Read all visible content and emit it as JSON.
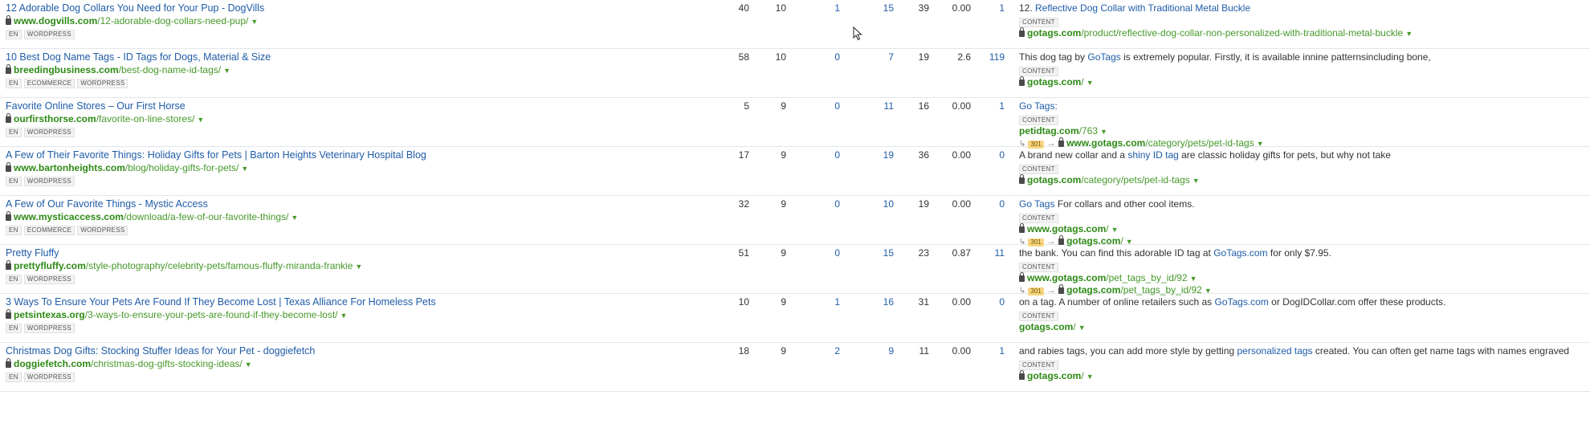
{
  "rows": [
    {
      "title": "12 Adorable Dog Collars You Need for Your Pup - DogVills",
      "domain": "www.dogvills.com",
      "path": "/12-adorable-dog-collars-need-pup/",
      "tags": [
        "EN",
        "WORDPRESS"
      ],
      "nums": [
        "40",
        "10",
        "1",
        "15",
        "39",
        "0.00",
        "1"
      ],
      "anchor_pre": "12. ",
      "anchor_link": "Reflective Dog Collar with Traditional Metal Buckle",
      "anchor_post": "",
      "content_label": "CONTENT",
      "target_domain": "gotags.com",
      "target_path": "/product/reflective-dog-collar-non-personalized-with-traditional-metal-buckle",
      "target_secure": true
    },
    {
      "title": "10 Best Dog Name Tags - ID Tags for Dogs, Material & Size",
      "domain": "breedingbusiness.com",
      "path": "/best-dog-name-id-tags/",
      "tags": [
        "EN",
        "ECOMMERCE",
        "WORDPRESS"
      ],
      "nums": [
        "58",
        "10",
        "0",
        "7",
        "19",
        "2.6",
        "119"
      ],
      "anchor_pre": "This dog tag by ",
      "anchor_link": "GoTags",
      "anchor_post": " is extremely popular. Firstly, it is available innine patternsincluding bone,",
      "content_label": "CONTENT",
      "target_domain": "gotags.com",
      "target_path": "/",
      "target_secure": true
    },
    {
      "title": "Favorite Online Stores – Our First Horse",
      "domain": "ourfirsthorse.com",
      "path": "/favorite-on-line-stores/",
      "tags": [
        "EN",
        "WORDPRESS"
      ],
      "nums": [
        "5",
        "9",
        "0",
        "11",
        "16",
        "0.00",
        "1"
      ],
      "anchor_pre": "",
      "anchor_link": "Go Tags:",
      "anchor_post": "",
      "content_label": "CONTENT",
      "target_domain": "petidtag.com",
      "target_path": "/763",
      "target_secure": false,
      "redirect": {
        "code": "301",
        "domain": "www.gotags.com",
        "path": "/category/pets/pet-id-tags",
        "secure": true
      }
    },
    {
      "title": "A Few of Their Favorite Things: Holiday Gifts for Pets | Barton Heights Veterinary Hospital Blog",
      "domain": "www.bartonheights.com",
      "path": "/blog/holiday-gifts-for-pets/",
      "tags": [
        "EN",
        "WORDPRESS"
      ],
      "nums": [
        "17",
        "9",
        "0",
        "19",
        "36",
        "0.00",
        "0"
      ],
      "anchor_pre": "A brand new collar and a ",
      "anchor_link": "shiny ID tag",
      "anchor_post": " are classic holiday gifts for pets, but why not take",
      "content_label": "CONTENT",
      "target_domain": "gotags.com",
      "target_path": "/category/pets/pet-id-tags",
      "target_secure": true
    },
    {
      "title": "A Few of Our Favorite Things - Mystic Access",
      "domain": "www.mysticaccess.com",
      "path": "/download/a-few-of-our-favorite-things/",
      "tags": [
        "EN",
        "ECOMMERCE",
        "WORDPRESS"
      ],
      "nums": [
        "32",
        "9",
        "0",
        "10",
        "19",
        "0.00",
        "0"
      ],
      "anchor_pre": "",
      "anchor_link": "Go Tags",
      "anchor_post": " For collars and other cool items.",
      "content_label": "CONTENT",
      "target_domain": "www.gotags.com",
      "target_path": "/",
      "target_secure": true,
      "redirect": {
        "code": "301",
        "domain": "gotags.com",
        "path": "/",
        "secure": true
      }
    },
    {
      "title": "Pretty Fluffy",
      "domain": "prettyfluffy.com",
      "path": "/style-photography/celebrity-pets/famous-fluffy-miranda-frankie",
      "tags": [
        "EN",
        "WORDPRESS"
      ],
      "nums": [
        "51",
        "9",
        "0",
        "15",
        "23",
        "0.87",
        "11"
      ],
      "anchor_pre": "the bank. You can find this adorable ID tag at ",
      "anchor_link": "GoTags.com",
      "anchor_post": " for only $7.95.",
      "content_label": "CONTENT",
      "target_domain": "www.gotags.com",
      "target_path": "/pet_tags_by_id/92",
      "target_secure": true,
      "redirect": {
        "code": "301",
        "domain": "gotags.com",
        "path": "/pet_tags_by_id/92",
        "secure": true
      }
    },
    {
      "title": "3 Ways To Ensure Your Pets Are Found If They Become Lost | Texas Alliance For Homeless Pets",
      "domain": "petsintexas.org",
      "path": "/3-ways-to-ensure-your-pets-are-found-if-they-become-lost/",
      "tags": [
        "EN",
        "WORDPRESS"
      ],
      "nums": [
        "10",
        "9",
        "1",
        "16",
        "31",
        "0.00",
        "0"
      ],
      "anchor_pre": "on a tag. A number of online retailers such as ",
      "anchor_link": "GoTags.com",
      "anchor_post": " or DogIDCollar.com offer these products.",
      "content_label": "CONTENT",
      "target_domain": "gotags.com",
      "target_path": "/",
      "target_secure": false
    },
    {
      "title": "Christmas Dog Gifts: Stocking Stuffer Ideas for Your Pet - doggiefetch",
      "domain": "doggiefetch.com",
      "path": "/christmas-dog-gifts-stocking-ideas/",
      "tags": [
        "EN",
        "WORDPRESS"
      ],
      "nums": [
        "18",
        "9",
        "2",
        "9",
        "11",
        "0.00",
        "1"
      ],
      "anchor_pre": "and rabies tags, you can add more style by getting ",
      "anchor_link": "personalized tags",
      "anchor_post": " created. You can often get name tags with names engraved",
      "content_label": "CONTENT",
      "target_domain": "gotags.com",
      "target_path": "/",
      "target_secure": true
    }
  ],
  "colors": {
    "link": "#1f5ca8",
    "url": "#46992a",
    "url_domain": "#2d8a15",
    "redirect_badge": "#f7d580"
  },
  "icons": {
    "secure": "lock-icon",
    "dropdown": "caret-down-icon",
    "redirect": "redirect-arrow-icon",
    "pointer": "mouse-cursor-icon"
  }
}
